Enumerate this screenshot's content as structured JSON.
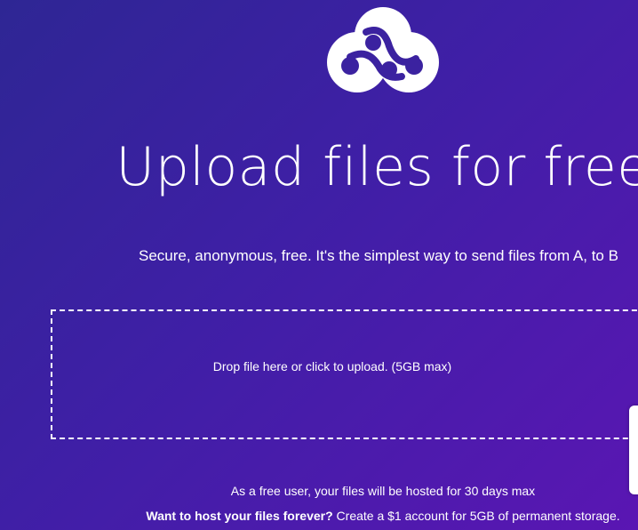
{
  "logo": {
    "icon": "infinity-cloud-logo-icon"
  },
  "title": "Upload files for free",
  "subtitle": "Secure, anonymous, free. It's the simplest way to send files from A, to B",
  "dropzone": {
    "label": "Drop file here or click to upload. (5GB max)"
  },
  "footer": {
    "free_note": "As a free user, your files will be hosted for 30 days max",
    "forever_question": "Want to host your files forever?",
    "forever_cta": "Create a $1 account for 5GB of permanent storage."
  },
  "colors": {
    "gradient_start": "#2e2694",
    "gradient_end": "#5a16b3",
    "text": "#ffffff"
  }
}
